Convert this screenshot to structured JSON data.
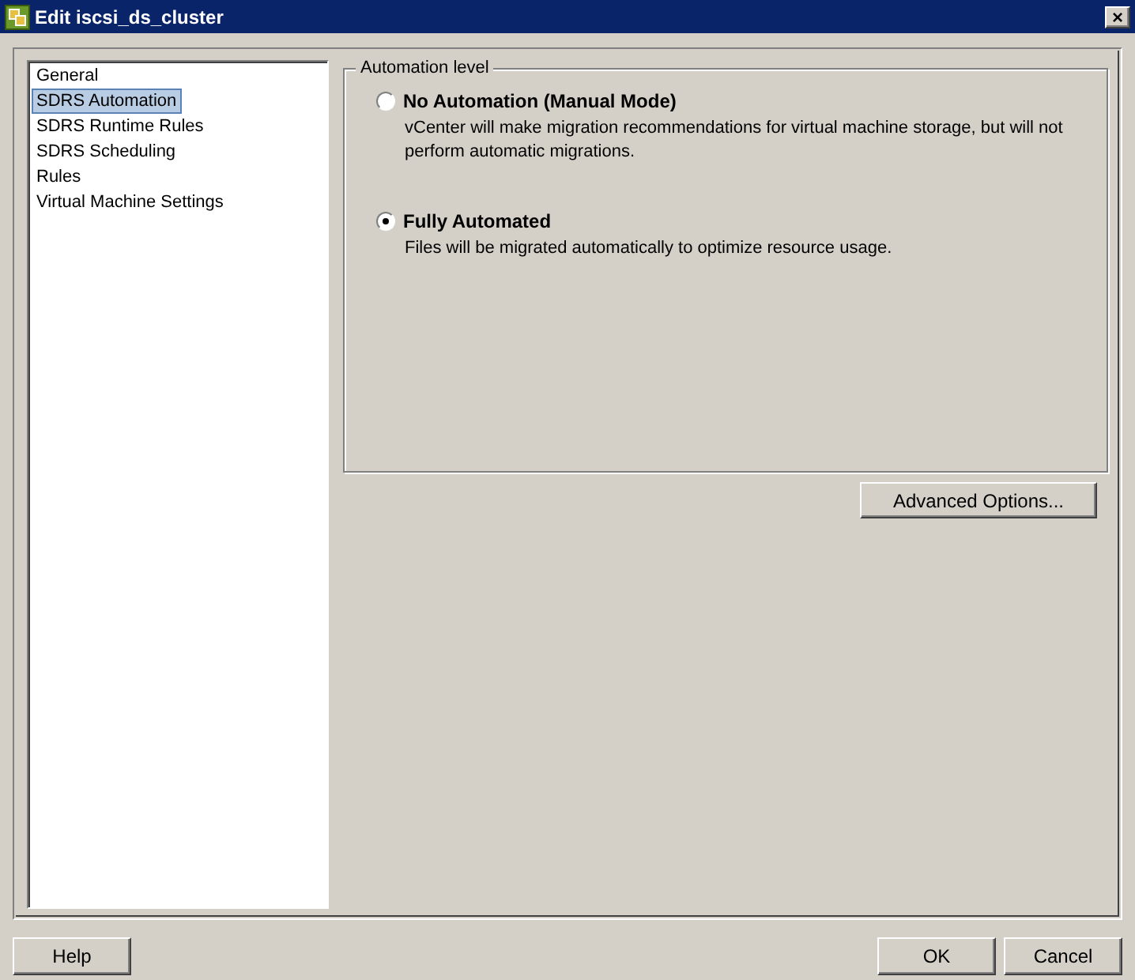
{
  "window": {
    "title": "Edit iscsi_ds_cluster",
    "close_label": "×"
  },
  "sidebar": {
    "items": [
      {
        "label": "General",
        "selected": false
      },
      {
        "label": "SDRS Automation",
        "selected": true
      },
      {
        "label": "SDRS Runtime Rules",
        "selected": false
      },
      {
        "label": "SDRS Scheduling",
        "selected": false
      },
      {
        "label": "Rules",
        "selected": false
      },
      {
        "label": "Virtual Machine Settings",
        "selected": false
      }
    ]
  },
  "automation_level": {
    "title": "Automation level",
    "options": [
      {
        "label": "No Automation (Manual Mode)",
        "description": "vCenter will make migration recommendations for virtual machine storage, but will not perform automatic migrations.",
        "selected": false
      },
      {
        "label": "Fully Automated",
        "description": "Files will be migrated automatically to optimize resource usage.",
        "selected": true
      }
    ]
  },
  "advanced_button": "Advanced Options...",
  "footer": {
    "help": "Help",
    "ok": "OK",
    "cancel": "Cancel"
  }
}
